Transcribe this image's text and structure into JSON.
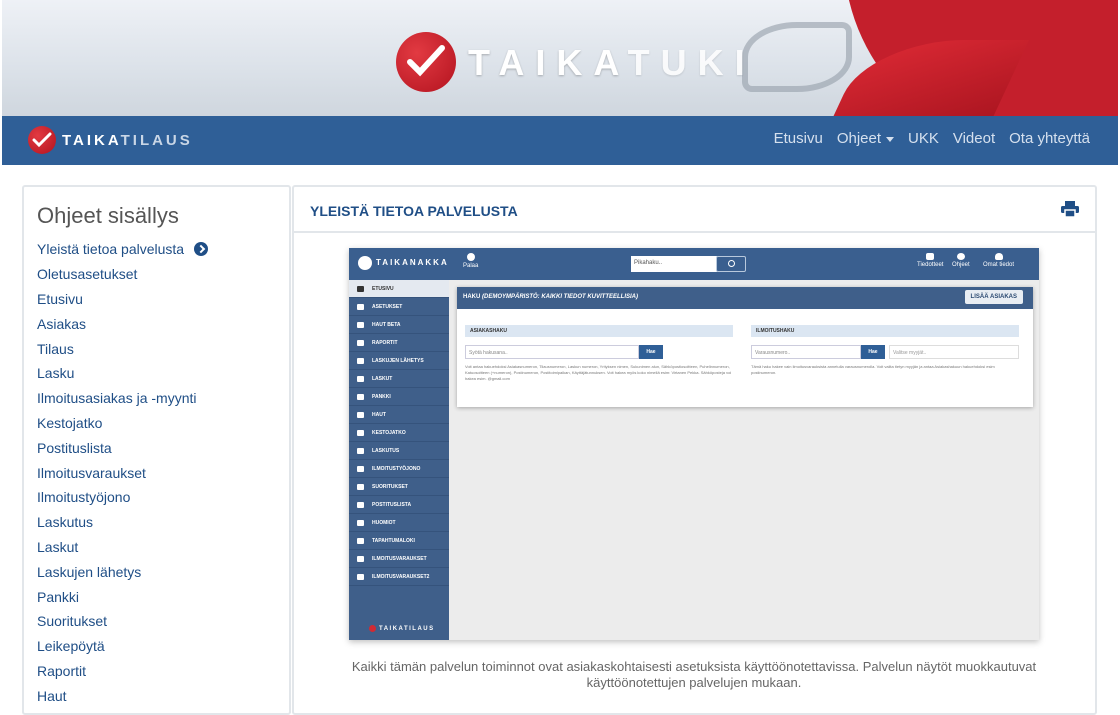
{
  "banner": {
    "brand_part1": "TAIKA",
    "brand_part2": "TUKI"
  },
  "navbar": {
    "brand_part1": "TAIKA",
    "brand_part2": "TILAUS",
    "links": [
      "Etusivu",
      "Ohjeet",
      "UKK",
      "Videot",
      "Ota yhteyttä"
    ]
  },
  "toc": {
    "title": "Ohjeet sisällys",
    "items": [
      "Yleistä tietoa palvelusta",
      "Oletusasetukset",
      "Etusivu",
      "Asiakas",
      "Tilaus",
      "Lasku",
      "Ilmoitusasiakas ja -myynti",
      "Kestojatko",
      "Postituslista",
      "Ilmoitusvaraukset",
      "Ilmoitustyöjono",
      "Laskutus",
      "Laskut",
      "Laskujen lähetys",
      "Pankki",
      "Suoritukset",
      "Leikepöytä",
      "Raportit",
      "Haut"
    ]
  },
  "panel": {
    "title": "YLEISTÄ TIETOA PALVELUSTA",
    "caption": "Kaikki tämän palvelun toiminnot ovat asiakaskohtaisesti asetuksista käyttöönotettavissa. Palvelun näytöt muokkautuvat käyttöönotettujen palvelujen mukaan."
  },
  "shot": {
    "brand": "TAIKANAKKA",
    "back": "Palaa",
    "search_placeholder": "Pikahaku..",
    "icons": [
      "Tiedotteet",
      "Ohjeet",
      "Omat tiedot"
    ],
    "menu": [
      "ETUSIVU",
      "ASETUKSET",
      "HAUT BETA",
      "RAPORTIT",
      "LASKUJEN LÄHETYS",
      "LASKUT",
      "PANKKI",
      "HAUT",
      "KESTOJATKO",
      "LASKUTUS",
      "ILMOITUSTYÖJONO",
      "SUORITUKSET",
      "POSTITUSLISTA",
      "HUOMIOT",
      "TAPAHTUMALOKI",
      "ILMOITUSVARAUKSET",
      "ILMOITUSVARAUKSET2"
    ],
    "footer_brand": "TAIKATILAUS",
    "card_title": "HAKU",
    "card_note": "(DEMOYMPÄRISTÖ: KAIKKI TIEDOT KUVITTEELLISIA)",
    "add_button": "LISÄÄ ASIAKAS",
    "left": {
      "heading": "ASIAKASHAKU",
      "placeholder": "Syötä hakusana..",
      "button": "Hae",
      "help": "Voit antaa hakuehdoksi Asiakasnumeron, Tilausnumeron, Laskun numeron, Yrityksen nimen, Sukunimen alun, Sähköpostiosoitteen, Puhelinnumeron, Katuosoitteen (+numeron), Postinumeron, Postitoimipaikan, Käyttäjätunnuksen. Voit hakea myös koko nimellä esim: Virtanen Pekka. Sähköposteja voi hakea esim. @gmail.com"
    },
    "right": {
      "heading": "ILMOITUSHAKU",
      "placeholder": "Varausnumero..",
      "button": "Hae",
      "select_placeholder": "Valitse myyjät..",
      "help": "Tämä haku hakee vain ilmoitusvarauksista annetulla varausnumerolla. Voit valita tietyn myyjän ja antaa Asiakashakuun hakuehdoksi esim postinumeron."
    }
  }
}
